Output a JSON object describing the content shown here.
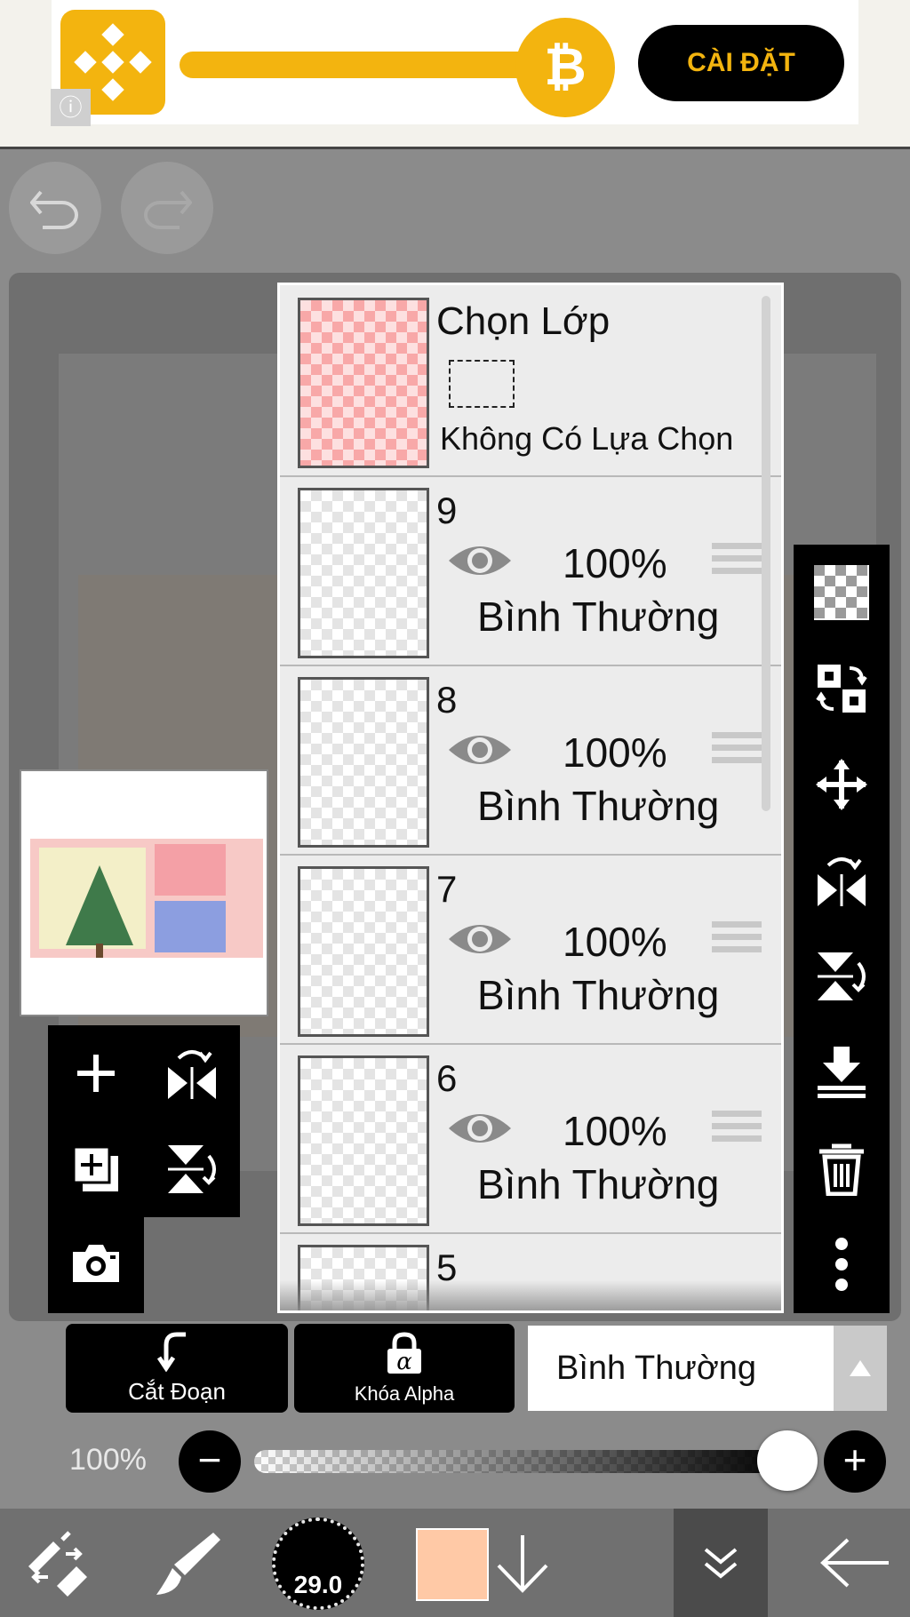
{
  "ad": {
    "install_label": "CÀI ĐẶT",
    "info_icon": "info-icon",
    "logo_icon": "binance-logo",
    "coin_icon": "bitcoin-icon",
    "coin_symbol": "₿",
    "info_symbol": "ⓘ",
    "colors": {
      "brand": "#f3b40f",
      "button": "#000000"
    }
  },
  "toolbar": {
    "undo_icon": "undo-icon",
    "redo_icon": "redo-icon"
  },
  "layers_panel": {
    "selection_layer": {
      "title": "Chọn Lớp",
      "subtitle": "Không Có Lựa Chọn"
    },
    "layers": [
      {
        "name": "9",
        "opacity": "100%",
        "blend_mode": "Bình Thường"
      },
      {
        "name": "8",
        "opacity": "100%",
        "blend_mode": "Bình Thường"
      },
      {
        "name": "7",
        "opacity": "100%",
        "blend_mode": "Bình Thường"
      },
      {
        "name": "6",
        "opacity": "100%",
        "blend_mode": "Bình Thường"
      },
      {
        "name": "5"
      }
    ]
  },
  "right_tools": [
    "transparent-background-icon",
    "swap-layer-icon",
    "move-icon",
    "flip-horizontal-icon",
    "flip-vertical-icon",
    "merge-down-icon",
    "trash-icon",
    "more-icon"
  ],
  "left_tools": [
    "add-layer-icon",
    "flip-horizontal-icon",
    "duplicate-layer-icon",
    "flip-vertical-icon",
    "camera-icon"
  ],
  "layer_options": {
    "clipping_label": "Cắt Đoạn",
    "alpha_lock_label": "Khóa Alpha",
    "alpha_symbol": "α",
    "blend_mode_value": "Bình Thường"
  },
  "opacity": {
    "label": "100%",
    "value": 1.0,
    "minus": "−",
    "plus": "+"
  },
  "bottom_bar": {
    "brush_size": "29.0",
    "color": "#ffc9a6",
    "tools": [
      "transform-icon",
      "brush-icon",
      "brush-size-indicator",
      "color-swatch",
      "down-arrow-icon",
      "double-chevron-down-icon",
      "back-arrow-icon"
    ]
  }
}
